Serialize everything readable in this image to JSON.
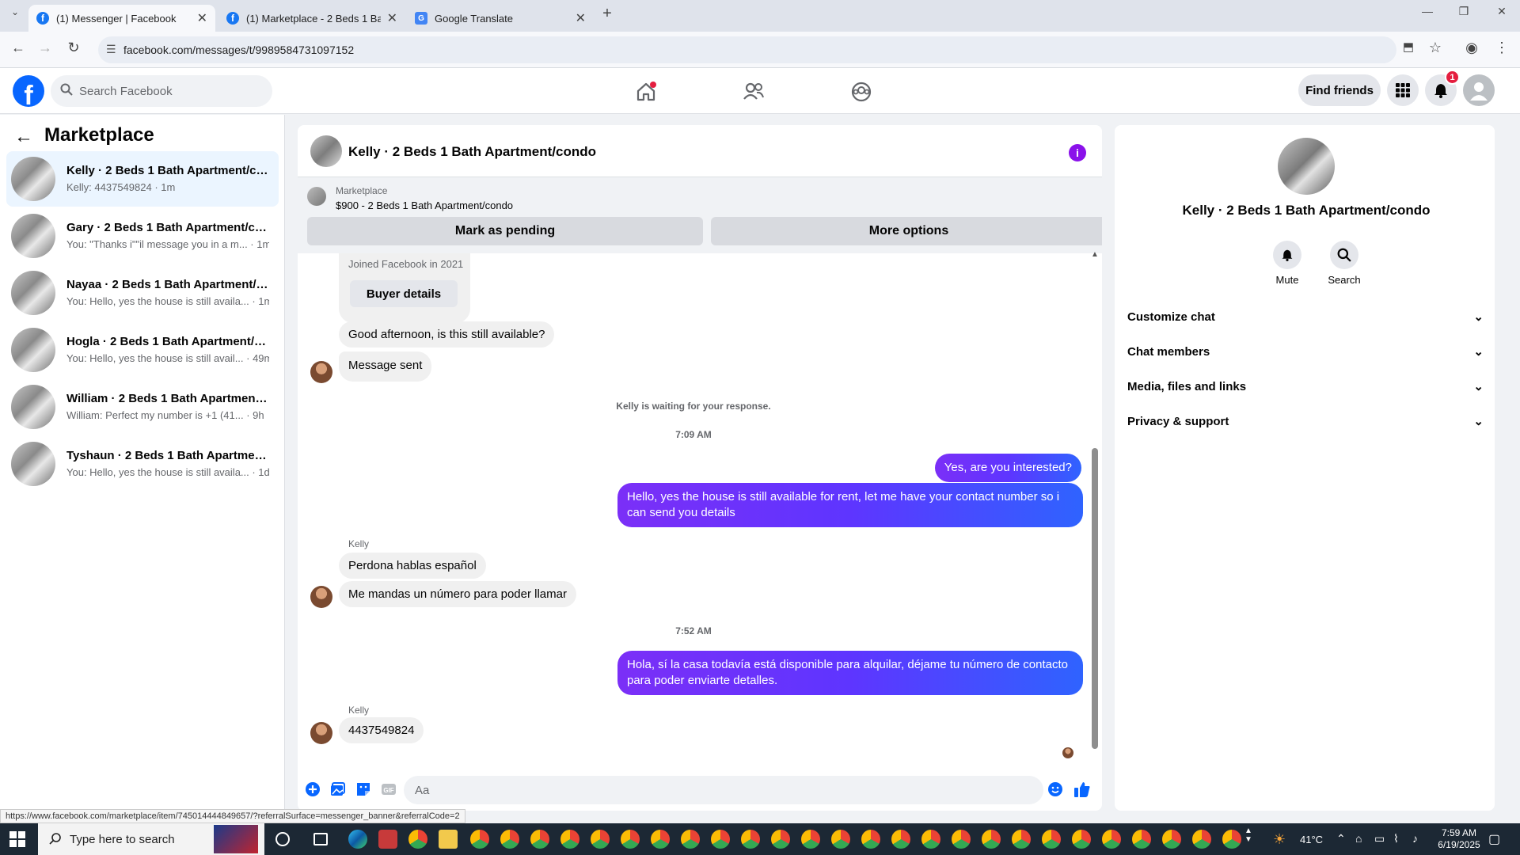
{
  "browser": {
    "tabs": [
      {
        "title": "(1) Messenger | Facebook",
        "icon": "facebook-icon",
        "active": true
      },
      {
        "title": "(1) Marketplace - 2 Beds 1 Bath",
        "icon": "facebook-icon",
        "active": false
      },
      {
        "title": "Google Translate",
        "icon": "google-translate-icon",
        "active": false
      }
    ],
    "url": "facebook.com/messages/t/9989584731097152"
  },
  "fb": {
    "search_placeholder": "Search Facebook",
    "find_friends": "Find friends",
    "notif_count": "1"
  },
  "left": {
    "title": "Marketplace",
    "conversations": [
      {
        "name": "Kelly · 2 Beds 1 Bath Apartment/condo",
        "preview": "Kelly: 4437549824 · 1m"
      },
      {
        "name": "Gary · 2 Beds 1 Bath Apartment/condo",
        "preview": "You: \"Thanks i\"\"il message you in a m... · 1m"
      },
      {
        "name": "Nayaa · 2 Beds 1 Bath Apartment/condo",
        "preview": "You: Hello, yes the house is still availa... · 1m"
      },
      {
        "name": "Hogla · 2 Beds 1 Bath Apartment/condo",
        "preview": "You: Hello, yes the house is still avail... · 49m"
      },
      {
        "name": "William · 2 Beds 1 Bath Apartment/condo",
        "preview": "William: Perfect my number is +1 (41... · 9h"
      },
      {
        "name": "Tyshaun · 2 Beds 1 Bath Apartment/condo",
        "preview": "You: Hello, yes the house is still availa... · 1d"
      }
    ]
  },
  "chat": {
    "title": "Kelly · 2 Beds 1 Bath Apartment/condo",
    "banner_label": "Marketplace",
    "banner_listing": "$900 - 2 Beds 1 Bath Apartment/condo",
    "mark_pending": "Mark as pending",
    "more_options": "More options",
    "joined": "Joined Facebook in 2021",
    "buyer_details": "Buyer details",
    "msg1": "Good afternoon, is this still available?",
    "msg2": "Message sent",
    "waiting": "Kelly is waiting for your response.",
    "time1": "7:09 AM",
    "out1": "Yes, are you interested?",
    "out2": "Hello, yes the house is still available for rent, let me have your contact number so i can send you details",
    "sender1": "Kelly",
    "in3": "Perdona hablas español",
    "in4": "Me mandas un número para poder llamar",
    "time2": "7:52 AM",
    "out3": "Hola, sí la casa todavía está disponible para alquilar, déjame tu número de contacto para poder enviarte detalles.",
    "sender2": "Kelly",
    "in5": "4437549824",
    "composer_placeholder": "Aa"
  },
  "right": {
    "name": "Kelly · 2 Beds 1 Bath Apartment/condo",
    "mute": "Mute",
    "search": "Search",
    "sections": [
      "Customize chat",
      "Chat members",
      "Media, files and links",
      "Privacy & support"
    ]
  },
  "status_url": "https://www.facebook.com/marketplace/item/745014444849657/?referralSurface=messenger_banner&referralCode=2",
  "taskbar": {
    "search_placeholder": "Type here to search",
    "temp": "41°C",
    "time": "7:59 AM",
    "date": "6/19/2025"
  }
}
